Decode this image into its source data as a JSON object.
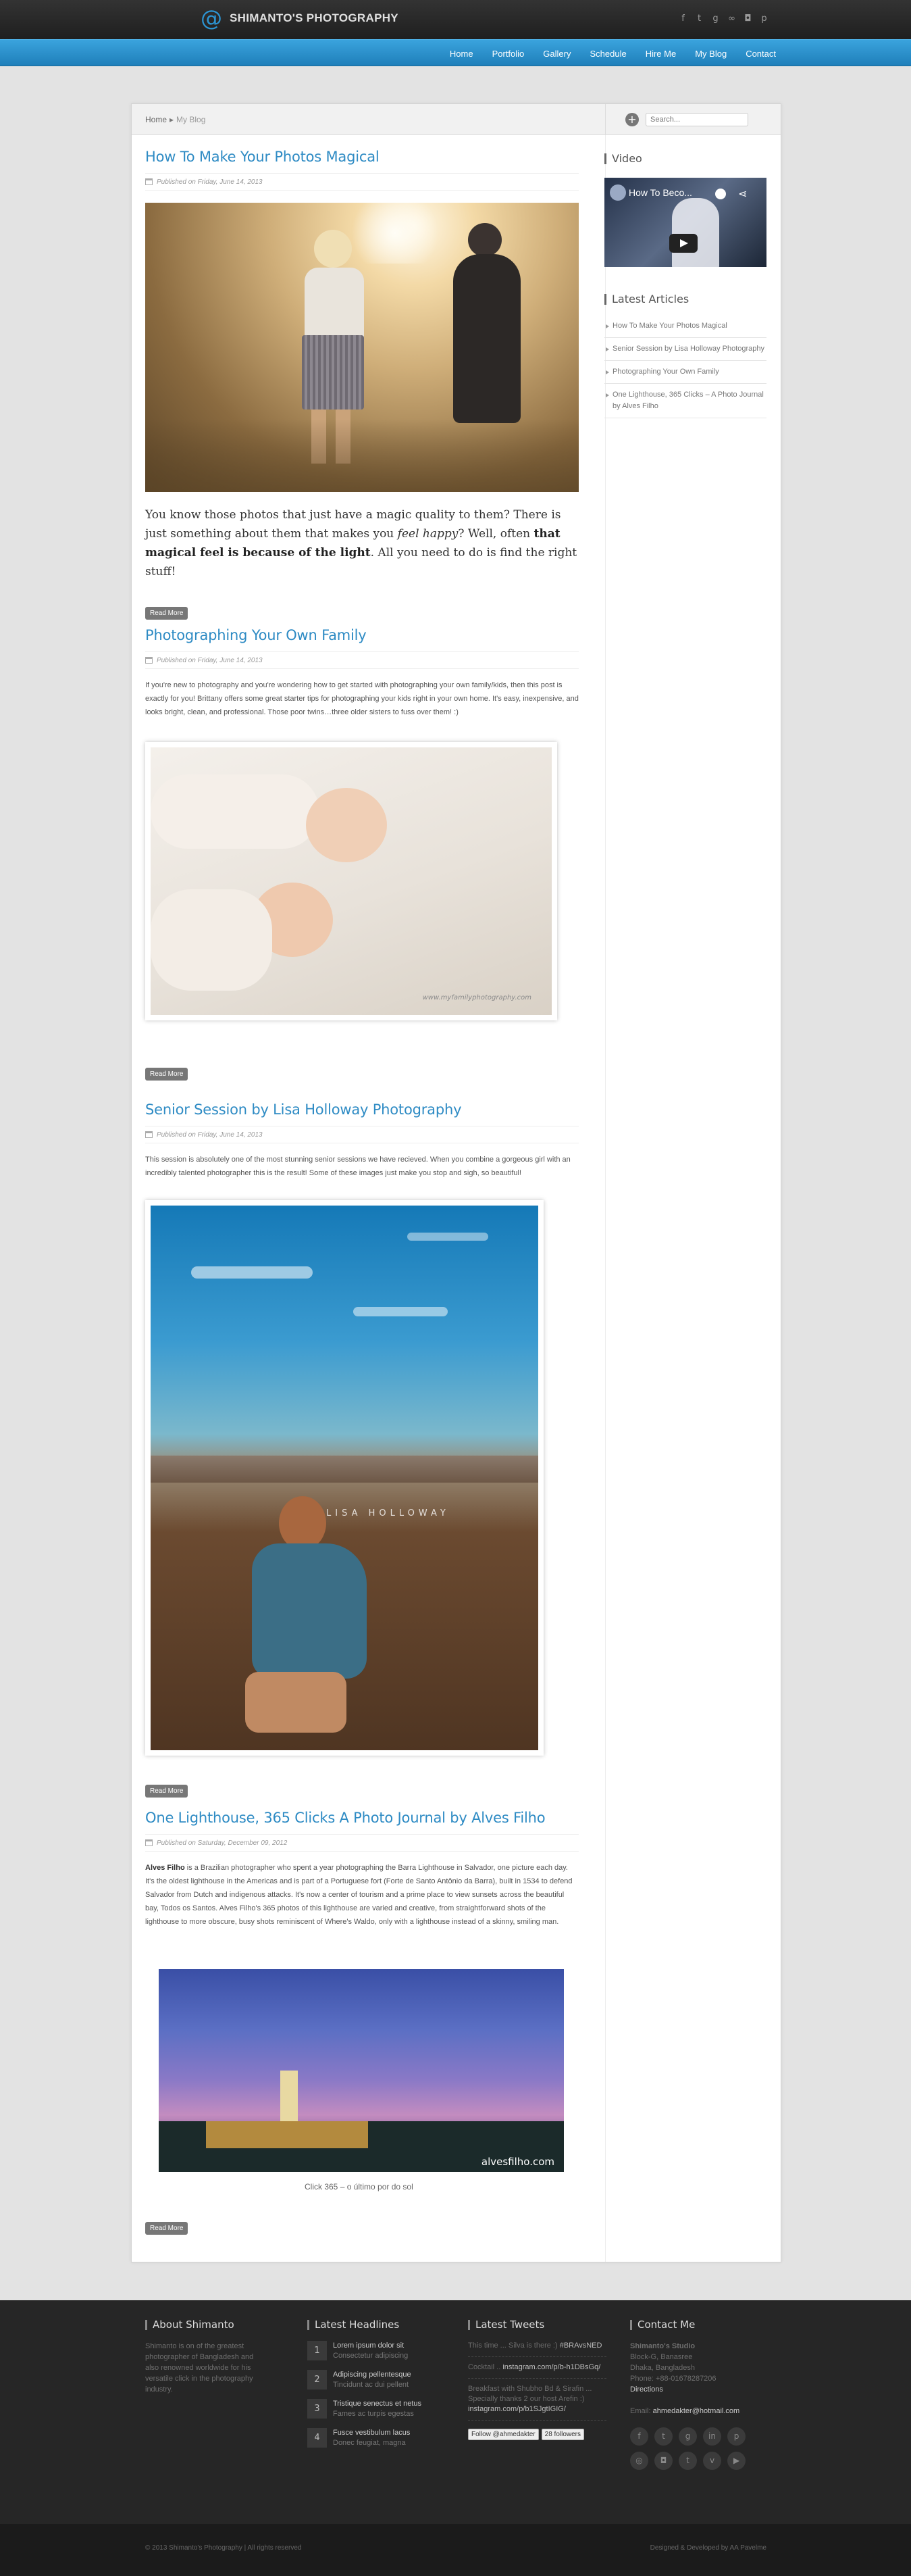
{
  "header": {
    "logo_symbol": "@",
    "site_name": "SHIMANTO'S PHOTOGRAPHY",
    "social_icons": [
      "facebook-icon",
      "twitter-icon",
      "google-plus-icon",
      "flickr-icon",
      "instagram-icon",
      "pinterest-icon"
    ],
    "social_glyphs": [
      "f",
      "t",
      "g",
      "∞",
      "◘",
      "p"
    ],
    "accent_color": "#2a93d2"
  },
  "nav": {
    "items": [
      "Home",
      "Portfolio",
      "Gallery",
      "Schedule",
      "Hire Me",
      "My Blog",
      "Contact"
    ]
  },
  "breadcrumb": {
    "home": "Home",
    "separator": "▸",
    "current": "My Blog"
  },
  "search": {
    "placeholder": "Search..."
  },
  "posts": [
    {
      "title": "How To Make Your Photos Magical",
      "date": "Published on Friday, June 14, 2013",
      "excerpt_parts": [
        "You know those photos that just have a magic quality to them? There is just something about them that makes you ",
        "feel happy",
        "? Well, often ",
        "that magical feel is because of the light",
        ". All you need to do is find the right stuff!"
      ],
      "read_more": "Read More"
    },
    {
      "title": "Photographing Your Own Family",
      "date": "Published on Friday, June 14, 2013",
      "excerpt": "If you're new to photography and you're wondering how to get started with photographing your own family/kids, then this post is exactly for you!  Brittany offers some great starter tips for photographing your kids right in your own home.  It's easy, inexpensive, and looks bright, clean, and professional.  Those poor twins…three older sisters to fuss over them! :)",
      "image_watermark": "www.myfamilyphotography.com",
      "read_more": "Read More"
    },
    {
      "title": "Senior Session by Lisa Holloway Photography",
      "date": "Published on Friday, June 14, 2013",
      "excerpt": "This session is absolutely one of the most stunning senior sessions we have recieved.  When you combine a gorgeous girl with an incredibly talented photographer this is the result!  Some of these images just make you stop and sigh, so beautiful!",
      "image_watermark": "LISA HOLLOWAY",
      "read_more": "Read More"
    },
    {
      "title": "One Lighthouse, 365 Clicks  A Photo Journal by Alves Filho",
      "date": "Published on Saturday, December 09, 2012",
      "excerpt_bold": "Alves Filho",
      "excerpt": " is a Brazilian photographer who spent a year photographing the Barra Lighthouse in Salvador, one picture each day. It's the oldest lighthouse in the Americas and is part of a Portuguese fort (Forte de Santo Antônio da Barra), built in 1534 to defend Salvador from Dutch and indigenous attacks. It's now a center of tourism and a prime place to view sunsets across the beautiful bay, Todos os Santos. Alves Filho's 365 photos of this lighthouse are varied and creative, from straightforward shots of the lighthouse to more obscure, busy shots reminiscent of Where's Waldo, only with a lighthouse instead of a skinny, smiling man.",
      "image_watermark": "alvesfilho.com",
      "caption": "Click 365 – o último por do sol",
      "read_more": "Read More"
    }
  ],
  "sidebar": {
    "video_title": "Video",
    "video_label": "How To Beco...",
    "latest_title": "Latest Articles",
    "latest": [
      "How To Make Your Photos Magical",
      "Senior Session by Lisa Holloway Photography",
      "Photographing Your Own Family",
      "One Lighthouse, 365 Clicks – A Photo Journal by Alves Filho"
    ]
  },
  "footer": {
    "about_title": "About Shimanto",
    "about_text": "Shimanto is on of the greatest photographer of Bangladesh and also renowned worldwide for his versatile click in the photography industry.",
    "headlines_title": "Latest Headlines",
    "headlines": [
      {
        "num": "1",
        "title": "Lorem ipsum dolor sit",
        "sub": "Consectetur adipiscing"
      },
      {
        "num": "2",
        "title": "Adipiscing pellentesque",
        "sub": "Tincidunt ac dui pellent"
      },
      {
        "num": "3",
        "title": "Tristique senectus et netus",
        "sub": "Fames ac turpis egestas"
      },
      {
        "num": "4",
        "title": "Fusce vestibulum lacus",
        "sub": "Donec feugiat, magna"
      }
    ],
    "tweets_title": "Latest Tweets",
    "tweets": [
      {
        "pre": "This time ... Silva is there :) ",
        "hi": "#BRAvsNED"
      },
      {
        "pre": "Cocktail .. ",
        "hi": "instagram.com/p/b-h1DBsGq/"
      },
      {
        "pre": "Breakfast with Shubho Bd & Sirafin ... Specially thanks 2 our host Arefin :) ",
        "hi": "instagram.com/p/b1SJgtIGIG/"
      }
    ],
    "follow_button": "Follow @ahmedakter",
    "followers": "28 followers",
    "contact_title": "Contact Me",
    "contact_name": "Shimanto's Studio",
    "contact_lines": [
      "Block-G, Banasree",
      "Dhaka, Bangladesh",
      "Phone: +88-01678287206"
    ],
    "directions": "Directions",
    "email_label": "Email: ",
    "email": "ahmedakter@hotmail.com",
    "social_row1": [
      "f",
      "t",
      "g",
      "in",
      "p"
    ],
    "social_row2": [
      "◎",
      "◘",
      "t",
      "v",
      "▶"
    ]
  },
  "bottom": {
    "copyright": "© 2013 Shimanto's Photography  |  All rights reserved",
    "credit": "Designed & Developed by AA Pavelme"
  }
}
